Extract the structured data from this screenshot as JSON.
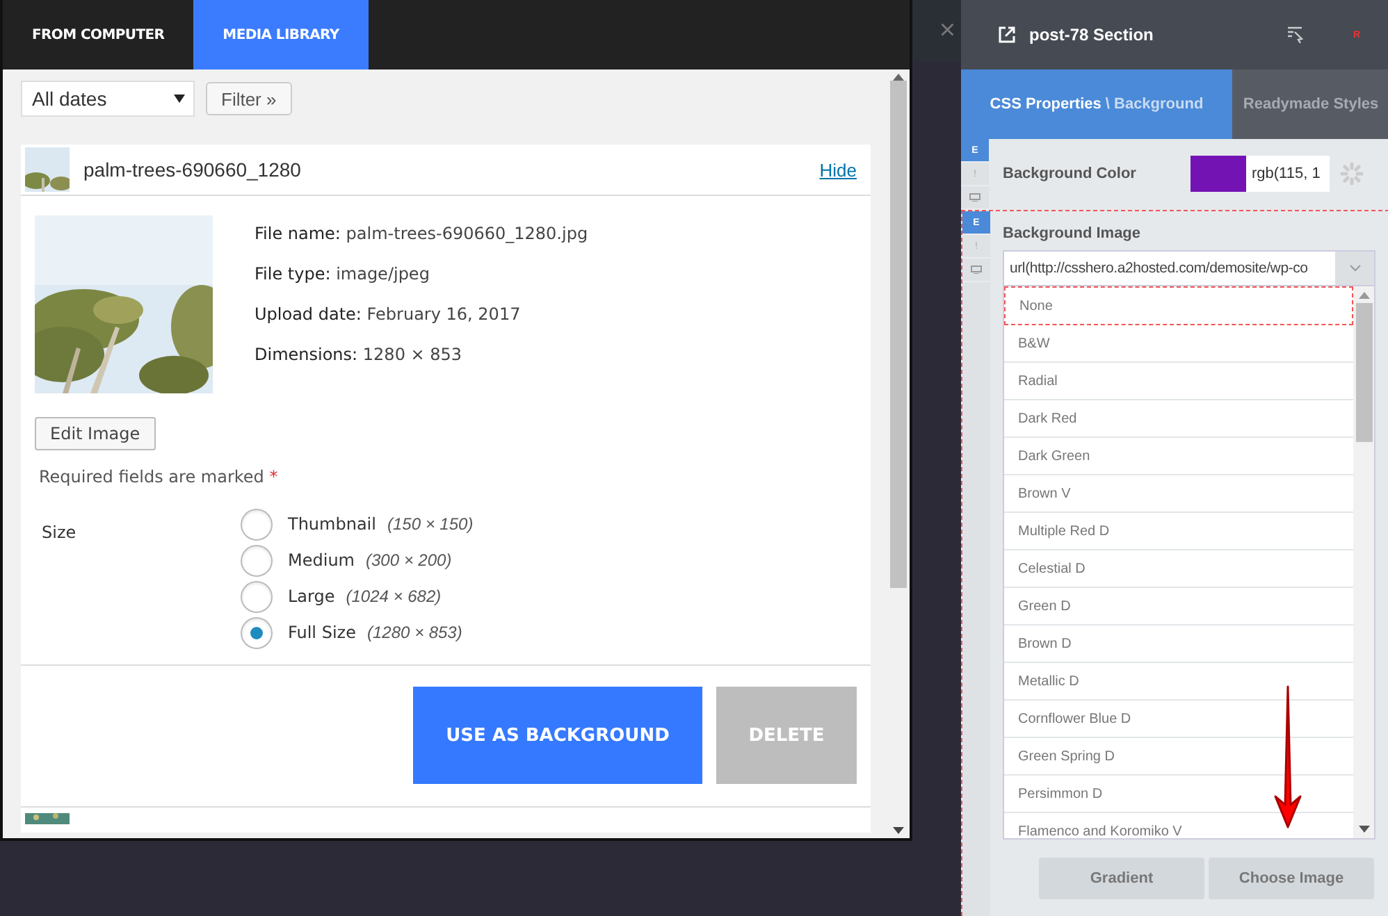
{
  "modal": {
    "tabs": [
      {
        "label": "FROM COMPUTER",
        "selected": false
      },
      {
        "label": "MEDIA LIBRARY",
        "selected": true
      }
    ],
    "date_filter": {
      "value": "All dates"
    },
    "filter_button": "Filter »",
    "attachment": {
      "title": "palm-trees-690660_1280",
      "hide_link": "Hide",
      "details": [
        {
          "label": "File name:",
          "value": "palm-trees-690660_1280.jpg"
        },
        {
          "label": "File type:",
          "value": "image/jpeg"
        },
        {
          "label": "Upload date:",
          "value": "February 16, 2017"
        },
        {
          "label": "Dimensions:",
          "value": "1280 × 853"
        }
      ],
      "edit_button": "Edit Image",
      "required_note": "Required fields are marked",
      "required_mark": "*",
      "size_label": "Size",
      "sizes": [
        {
          "name": "Thumbnail",
          "dims": "(150 × 150)",
          "selected": false
        },
        {
          "name": "Medium",
          "dims": "(300 × 200)",
          "selected": false
        },
        {
          "name": "Large",
          "dims": "(1024 × 682)",
          "selected": false
        },
        {
          "name": "Full Size",
          "dims": "(1280 × 853)",
          "selected": true
        }
      ],
      "buttons": [
        {
          "label": "USE AS BACKGROUND",
          "disabled": false
        },
        {
          "label": "DELETE",
          "disabled": true
        }
      ]
    }
  },
  "close_symbol": "×",
  "panel": {
    "title": "post-78 Section",
    "badge": "R",
    "tabs": [
      {
        "label": "CSS Properties",
        "sublabel": "\\ Background",
        "selected": true
      },
      {
        "label": "Readymade Styles",
        "selected": false
      }
    ],
    "properties": [
      {
        "kind": "color",
        "label": "Background Color",
        "color": "#7413b4",
        "value": "rgb(115, 1",
        "switches": [
          "E",
          "!"
        ]
      },
      {
        "label": "Background Image",
        "value": "url(http://csshero.a2hosted.com/demosite/wp-co",
        "switches": [
          "E",
          "!"
        ],
        "options": [
          {
            "label": "None",
            "selected": true
          },
          {
            "label": "B&W",
            "selected": false
          },
          {
            "label": "Radial",
            "selected": false
          },
          {
            "label": "Dark Red",
            "selected": false
          },
          {
            "label": "Dark Green",
            "selected": false
          },
          {
            "label": "Brown V",
            "selected": false
          },
          {
            "label": "Multiple Red D",
            "selected": false
          },
          {
            "label": "Celestial D",
            "selected": false
          },
          {
            "label": "Green D",
            "selected": false
          },
          {
            "label": "Brown D",
            "selected": false
          },
          {
            "label": "Metallic D",
            "selected": false
          },
          {
            "label": "Cornflower Blue D",
            "selected": false
          },
          {
            "label": "Green Spring D",
            "selected": false
          },
          {
            "label": "Persimmon D",
            "selected": false
          },
          {
            "label": "Flamenco and Koromiko V",
            "selected": false
          }
        ],
        "buttons": [
          "Gradient",
          "Choose Image"
        ]
      }
    ]
  }
}
